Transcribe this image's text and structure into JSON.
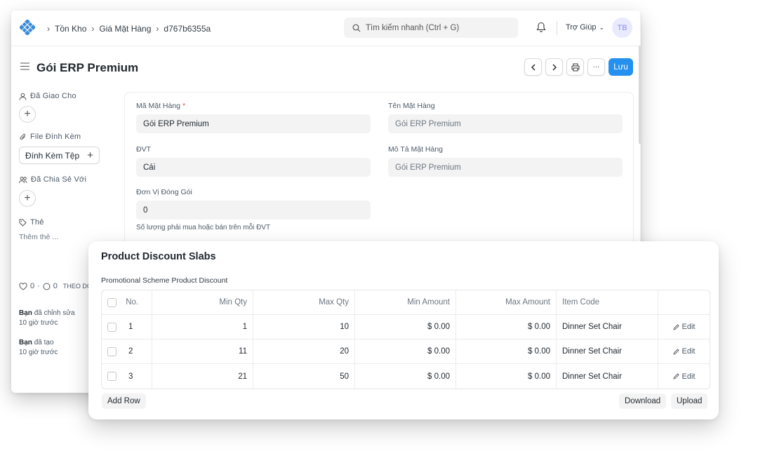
{
  "navbar": {
    "breadcrumbs": [
      "Tồn Kho",
      "Giá Mặt Hàng",
      "d767b6355a"
    ],
    "search_placeholder": "Tìm kiếm nhanh (Ctrl + G)",
    "help_label": "Trợ Giúp",
    "avatar_initials": "TB"
  },
  "page": {
    "title": "Gói ERP Premium",
    "save_label": "Lưu"
  },
  "sidebar": {
    "assigned_to": "Đã Giao Cho",
    "attachments": "File Đính Kèm",
    "attach_button": "Đính Kèm Tệp",
    "shared_with": "Đã Chia Sẻ Với",
    "tags": "Thẻ",
    "add_tag": "Thêm thẻ ...",
    "likes": "0",
    "comments": "0",
    "follow": "THEO DÕI",
    "edited_user": "Bạn",
    "edited_text": "đã chỉnh sửa",
    "edited_time": "10 giờ trước",
    "created_user": "Bạn",
    "created_text": "đã tạo",
    "created_time": "10 giờ trước"
  },
  "form": {
    "item_code_label": "Mã Mặt Hàng",
    "item_code_value": "Gói ERP Premium",
    "item_name_label": "Tên Mặt Hàng",
    "item_name_value": "Gói ERP Premium",
    "uom_label": "ĐVT",
    "uom_value": "Cái",
    "description_label": "Mô Tả Mặt Hàng",
    "description_value": "Gói ERP Premium",
    "packing_unit_label": "Đơn Vị Đóng Gói",
    "packing_unit_value": "0",
    "packing_unit_help": "Số lượng phải mua hoặc bán trên mỗi ĐVT"
  },
  "popup": {
    "title": "Product Discount Slabs",
    "subtitle": "Promotional Scheme Product Discount",
    "columns": [
      "No.",
      "Min Qty",
      "Max Qty",
      "Min Amount",
      "Max Amount",
      "Item Code"
    ],
    "rows": [
      {
        "no": "1",
        "min_qty": "1",
        "max_qty": "10",
        "min_amount": "$ 0.00",
        "max_amount": "$ 0.00",
        "item_code": "Dinner Set Chair",
        "edit": "Edit"
      },
      {
        "no": "2",
        "min_qty": "11",
        "max_qty": "20",
        "min_amount": "$ 0.00",
        "max_amount": "$ 0.00",
        "item_code": "Dinner Set Chair",
        "edit": "Edit"
      },
      {
        "no": "3",
        "min_qty": "21",
        "max_qty": "50",
        "min_amount": "$ 0.00",
        "max_amount": "$ 0.00",
        "item_code": "Dinner Set Chair",
        "edit": "Edit"
      }
    ],
    "add_row": "Add Row",
    "download": "Download",
    "upload": "Upload"
  },
  "colors": {
    "primary": "#2490ef",
    "logo": "#3a8bd8",
    "required": "#e24c4c"
  }
}
